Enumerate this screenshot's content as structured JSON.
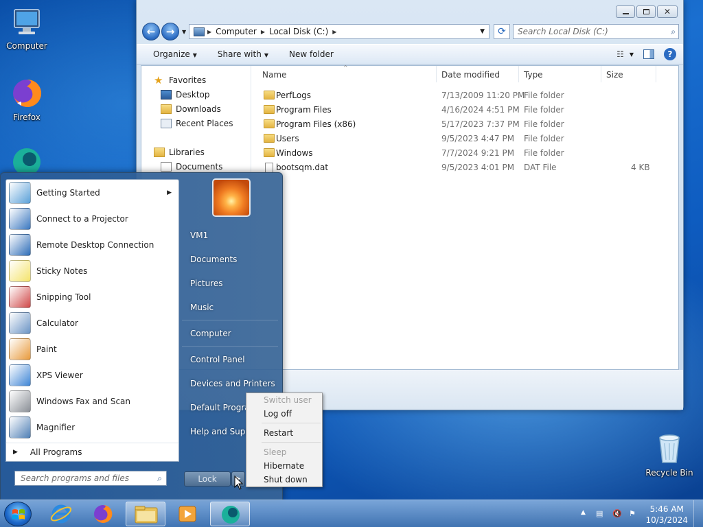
{
  "desktop": {
    "icons": [
      {
        "label": "Computer"
      },
      {
        "label": "Firefox"
      },
      {
        "label": "Recycle Bin"
      }
    ]
  },
  "explorer": {
    "address": {
      "root_label": "Computer",
      "current_label": "Local Disk (C:)"
    },
    "search_placeholder": "Search Local Disk (C:)",
    "toolbar": {
      "organize": "Organize",
      "share_with": "Share with",
      "new_folder": "New folder"
    },
    "nav": {
      "favorites": "Favorites",
      "desktop": "Desktop",
      "downloads": "Downloads",
      "recent_places": "Recent Places",
      "libraries": "Libraries",
      "documents": "Documents"
    },
    "columns": {
      "name": "Name",
      "date_modified": "Date modified",
      "type": "Type",
      "size": "Size"
    },
    "files": [
      {
        "name": "PerfLogs",
        "date": "7/13/2009 11:20 PM",
        "type": "File folder",
        "size": ""
      },
      {
        "name": "Program Files",
        "date": "4/16/2024 4:51 PM",
        "type": "File folder",
        "size": ""
      },
      {
        "name": "Program Files (x86)",
        "date": "5/17/2023 7:37 PM",
        "type": "File folder",
        "size": ""
      },
      {
        "name": "Users",
        "date": "9/5/2023 4:47 PM",
        "type": "File folder",
        "size": ""
      },
      {
        "name": "Windows",
        "date": "7/7/2024 9:21 PM",
        "type": "File folder",
        "size": ""
      },
      {
        "name": "bootsqm.dat",
        "date": "9/5/2023 4:01 PM",
        "type": "DAT File",
        "size": "4 KB"
      }
    ]
  },
  "start_menu": {
    "programs": [
      {
        "label": "Getting Started",
        "icon": "getting-started-icon",
        "color": "#5aa0d8"
      },
      {
        "label": "Connect to a Projector",
        "icon": "projector-icon",
        "color": "#3b78c0"
      },
      {
        "label": "Remote Desktop Connection",
        "icon": "remote-desktop-icon",
        "color": "#2e6db8"
      },
      {
        "label": "Sticky Notes",
        "icon": "sticky-notes-icon",
        "color": "#f4e36b"
      },
      {
        "label": "Snipping Tool",
        "icon": "snipping-tool-icon",
        "color": "#d04848"
      },
      {
        "label": "Calculator",
        "icon": "calculator-icon",
        "color": "#6a93c4"
      },
      {
        "label": "Paint",
        "icon": "paint-icon",
        "color": "#e89a3c"
      },
      {
        "label": "XPS Viewer",
        "icon": "xps-viewer-icon",
        "color": "#3f86d6"
      },
      {
        "label": "Windows Fax and Scan",
        "icon": "fax-scan-icon",
        "color": "#8a8f96"
      },
      {
        "label": "Magnifier",
        "icon": "magnifier-icon",
        "color": "#4f7fb5"
      }
    ],
    "all_programs": "All Programs",
    "search_placeholder": "Search programs and files",
    "right_items": {
      "user": "VM1",
      "documents": "Documents",
      "pictures": "Pictures",
      "music": "Music",
      "computer": "Computer",
      "control_panel": "Control Panel",
      "devices_printers": "Devices and Printers",
      "default_programs": "Default Programs",
      "help_support": "Help and Support"
    },
    "lock_label": "Lock"
  },
  "power_menu": {
    "switch_user": "Switch user",
    "log_off": "Log off",
    "restart": "Restart",
    "sleep": "Sleep",
    "hibernate": "Hibernate",
    "shut_down": "Shut down"
  },
  "taskbar": {
    "time": "5:46 AM",
    "date": "10/3/2024"
  }
}
